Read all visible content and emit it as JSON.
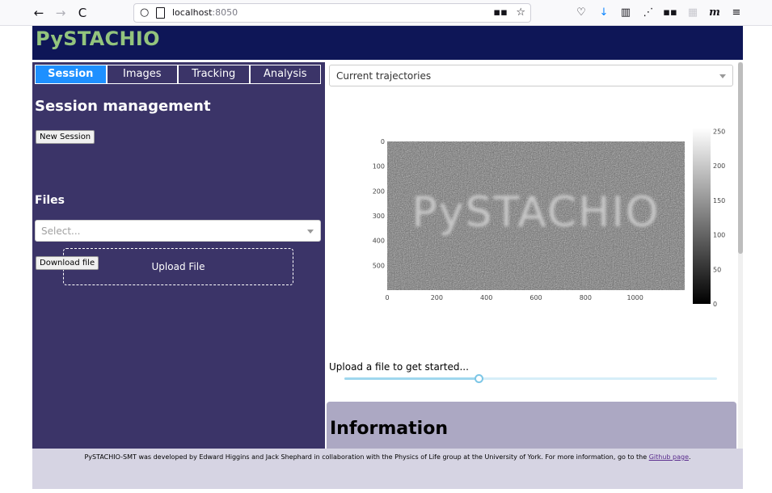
{
  "browser": {
    "url_host": "localhost",
    "url_port": ":8050",
    "back_icon": "←",
    "forward_icon": "→",
    "reload_icon": "C",
    "shield_icon": "○",
    "qr_icon": "▪▪",
    "bookmark_icon": "☆",
    "pocket_icon": "♡",
    "download_icon": "↓",
    "reader_icon": "▥",
    "extensions_icon": "⋰",
    "apps_icon": "▪▪",
    "ext_icon": "▦",
    "m_icon": "m",
    "menu_icon": "≡"
  },
  "app": {
    "title": "PySTACHIO",
    "tabs": [
      "Session",
      "Images",
      "Tracking",
      "Analysis"
    ],
    "active_tab": "Session",
    "session_title": "Session management",
    "new_session_label": "New Session",
    "files_title": "Files",
    "files_placeholder": "Select...",
    "upload_label": "Upload File",
    "download_label": "Download file",
    "view_dropdown": "Current trajectories",
    "upload_message": "Upload a file to get started...",
    "slider_value": 0.36,
    "info_title": "Information",
    "footer_text": "PySTACHIO-SMT was developed by Edward Higgins and Jack Shephard in collaboration with the Physics of Life group at the University of York. For more information, go to the ",
    "footer_link": "Github page",
    "footer_end": "."
  },
  "chart_data": {
    "type": "heatmap",
    "title": "",
    "image_text": "PySTACHIO",
    "x_ticks": [
      "0",
      "200",
      "400",
      "600",
      "800",
      "1000"
    ],
    "y_ticks": [
      "0",
      "100",
      "200",
      "300",
      "400",
      "500"
    ],
    "xlim": [
      0,
      1200
    ],
    "ylim": [
      0,
      600
    ],
    "colorbar_ticks": [
      "250",
      "200",
      "150",
      "100",
      "50",
      "0"
    ],
    "colorbar_range": [
      0,
      255
    ],
    "colorscale": "greys"
  },
  "colors": {
    "header_bg": "#0e1657",
    "title_color": "#93c47d",
    "panel_bg": "#3b3468",
    "tab_active": "#1e90ff",
    "info_bg": "#aca8c3",
    "footer_bg": "#d6d4e3"
  }
}
